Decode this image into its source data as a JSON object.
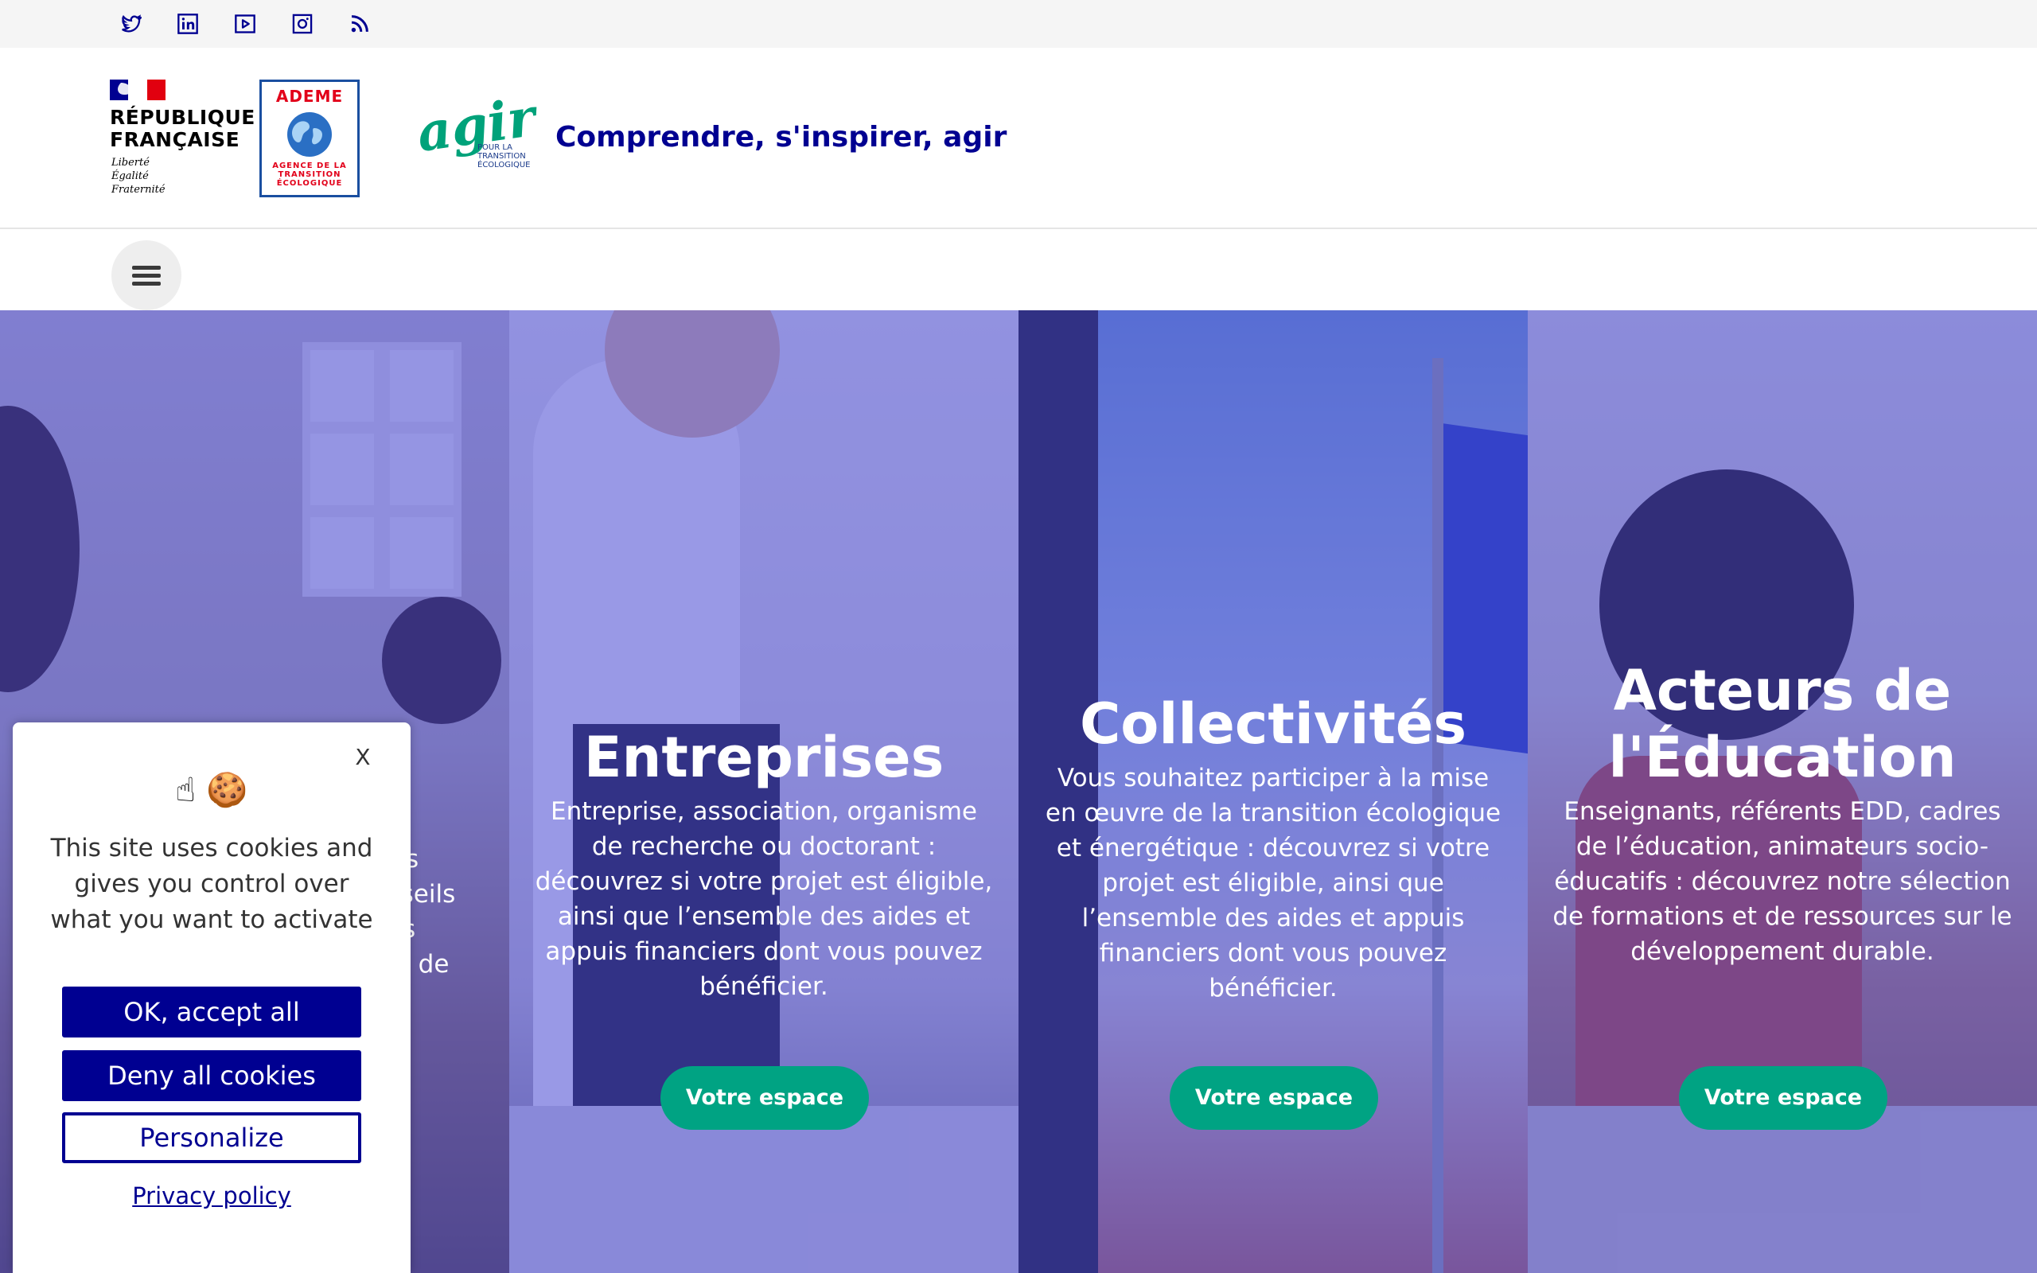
{
  "social": {
    "items": [
      {
        "name": "twitter",
        "icon": "twitter-icon"
      },
      {
        "name": "linkedin",
        "icon": "linkedin-icon"
      },
      {
        "name": "youtube",
        "icon": "youtube-icon"
      },
      {
        "name": "instagram",
        "icon": "instagram-icon"
      },
      {
        "name": "rss",
        "icon": "rss-icon"
      }
    ],
    "color": "#000091"
  },
  "header": {
    "rf_title_line1": "RÉPUBLIQUE",
    "rf_title_line2": "FRANÇAISE",
    "rf_motto_1": "Liberté",
    "rf_motto_2": "Égalité",
    "rf_motto_3": "Fraternité",
    "ademe_title": "ADEME",
    "ademe_sub_1": "AGENCE DE LA",
    "ademe_sub_2": "TRANSITION",
    "ademe_sub_3": "ÉCOLOGIQUE",
    "agir_word": "agir",
    "agir_sub_1": "POUR LA",
    "agir_sub_2": "TRANSITION",
    "agir_sub_3": "ÉCOLOGIQUE",
    "tagline": "Comprendre, s'inspirer, agir"
  },
  "nav": {
    "menu_icon": "hamburger-menu-icon"
  },
  "panels": [
    {
      "title": "",
      "description_partial": [
        "s",
        "nseils",
        "s",
        "nt de"
      ]
    },
    {
      "title": "Entreprises",
      "description": "Entreprise, association, organisme de recherche ou doctorant : découvrez si votre projet est éligible, ainsi que l’ensemble des aides et appuis financiers dont vous pouvez bénéficier.",
      "cta": "Votre espace"
    },
    {
      "title": "Collectivités",
      "description": "Vous souhaitez participer à la mise en œuvre de la transition écologique et énergétique : découvrez si votre projet est éligible, ainsi que l’ensemble des aides et appuis financiers dont vous pouvez bénéficier.",
      "cta": "Votre espace"
    },
    {
      "title": "Acteurs de l'Éducation",
      "description": "Enseignants, référents EDD, cadres de l’éducation, animateurs socio-éducatifs : découvrez notre sélection de formations et de ressources sur le développement durable.",
      "cta": "Votre espace"
    }
  ],
  "cookie": {
    "close": "X",
    "icons": "☝ 🍪",
    "text": "This site uses cookies and gives you control over what you want to activate",
    "accept": "OK, accept all",
    "deny": "Deny all cookies",
    "personalize": "Personalize",
    "privacy": "Privacy policy"
  },
  "colors": {
    "brand_blue": "#000091",
    "green_cta": "#00a383",
    "overlay": "#4646d2"
  }
}
